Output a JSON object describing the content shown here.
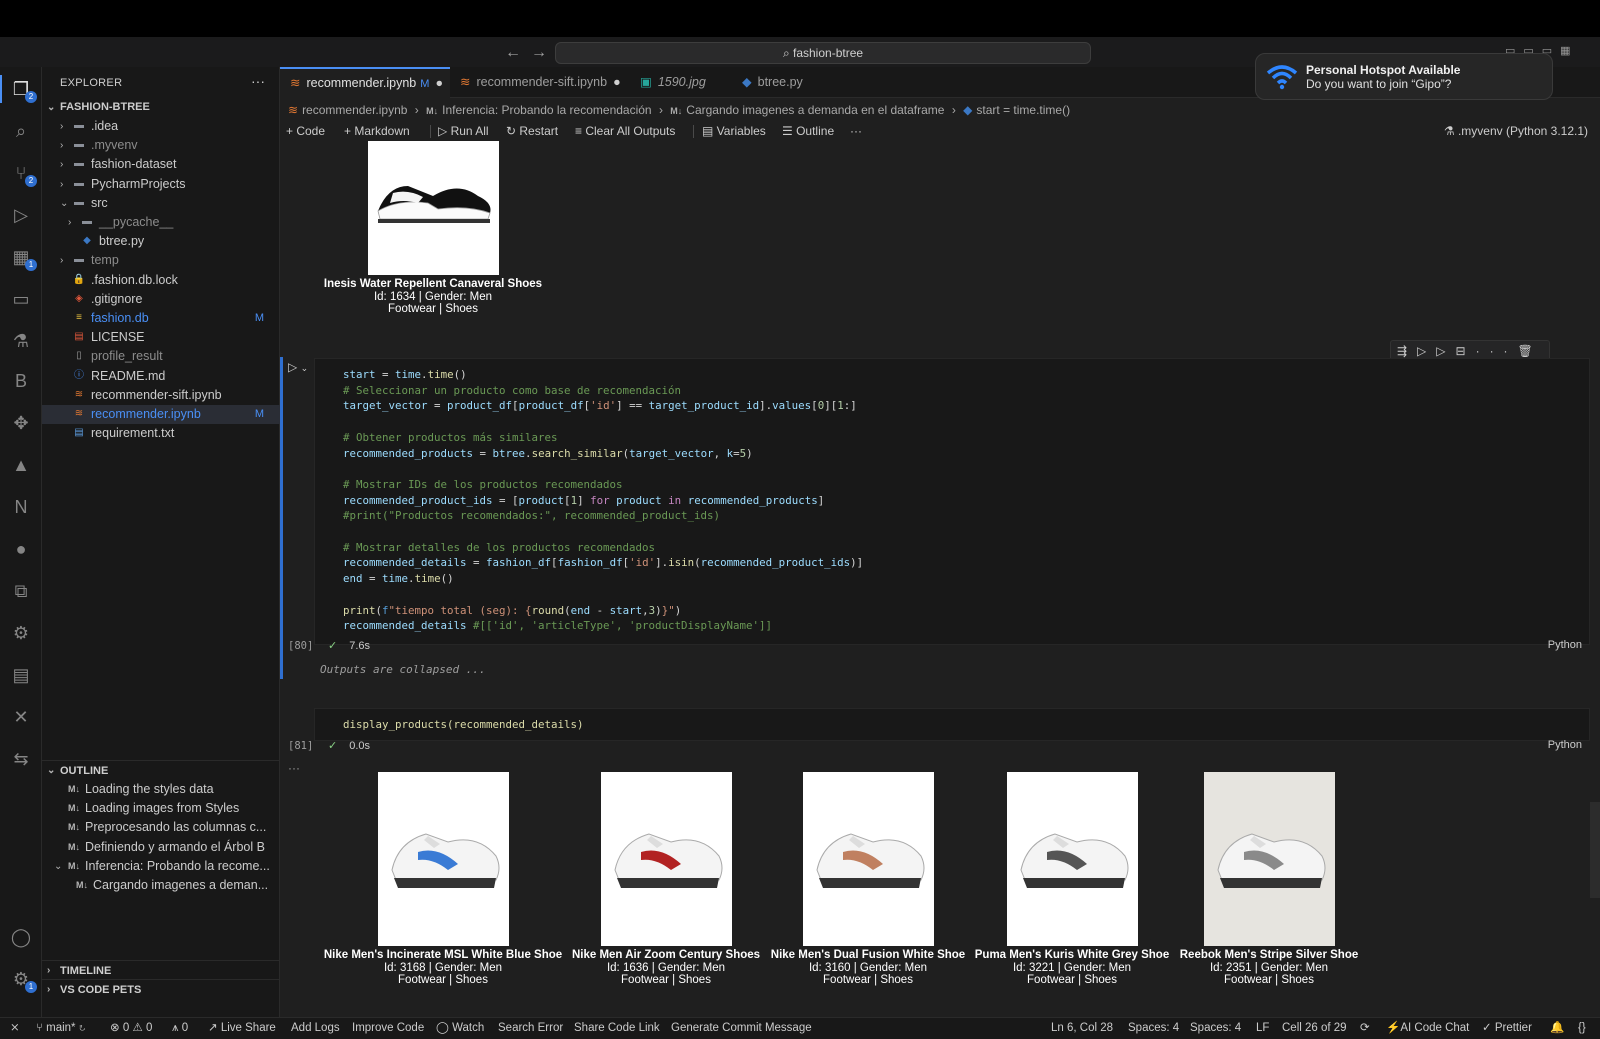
{
  "window": {
    "search_title": "fashion-btree"
  },
  "notification": {
    "title": "Personal Hotspot Available",
    "body": "Do you want to join “Gipo”?"
  },
  "explorer": {
    "title": "EXPLORER",
    "root": "FASHION-BTREE",
    "items": [
      {
        "label": ".idea",
        "type": "folder",
        "expanded": false,
        "depth": 1
      },
      {
        "label": ".myvenv",
        "type": "folder",
        "expanded": false,
        "depth": 1
      },
      {
        "label": "fashion-dataset",
        "type": "folder",
        "expanded": false,
        "depth": 1
      },
      {
        "label": "PycharmProjects",
        "type": "folder",
        "expanded": false,
        "depth": 1
      },
      {
        "label": "src",
        "type": "folder",
        "expanded": true,
        "depth": 1
      },
      {
        "label": "__pycache__",
        "type": "folder",
        "expanded": false,
        "depth": 2
      },
      {
        "label": "btree.py",
        "type": "python",
        "depth": 2
      },
      {
        "label": "temp",
        "type": "folder",
        "expanded": false,
        "depth": 1
      },
      {
        "label": ".fashion.db.lock",
        "type": "lock",
        "depth": 1
      },
      {
        "label": ".gitignore",
        "type": "git",
        "depth": 1
      },
      {
        "label": "fashion.db",
        "type": "db",
        "depth": 1,
        "badge": "M"
      },
      {
        "label": "LICENSE",
        "type": "license",
        "depth": 1
      },
      {
        "label": "profile_result",
        "type": "file",
        "depth": 1
      },
      {
        "label": "README.md",
        "type": "info",
        "depth": 1
      },
      {
        "label": "recommender-sift.ipynb",
        "type": "notebook",
        "depth": 1
      },
      {
        "label": "recommender.ipynb",
        "type": "notebook",
        "depth": 1,
        "badge": "M",
        "selected": true
      },
      {
        "label": "requirement.txt",
        "type": "text",
        "depth": 1
      }
    ]
  },
  "outline": {
    "title": "OUTLINE",
    "items": [
      {
        "label": "Loading the styles data",
        "depth": 1
      },
      {
        "label": "Loading images from Styles",
        "depth": 1
      },
      {
        "label": "Preprocesando las columnas c...",
        "depth": 1
      },
      {
        "label": "Definiendo y armando el Árbol B",
        "depth": 1
      },
      {
        "label": "Inferencia: Probando la recome...",
        "depth": 1,
        "expanded": true
      },
      {
        "label": "Cargando imagenes a deman...",
        "depth": 2
      }
    ]
  },
  "timeline": {
    "title": "TIMELINE"
  },
  "pets": {
    "title": "VS CODE PETS"
  },
  "tabs": [
    {
      "label": "recommender.ipynb",
      "badge": "M",
      "modified": true,
      "active": true
    },
    {
      "label": "recommender-sift.ipynb",
      "modified": true
    },
    {
      "label": "1590.jpg",
      "italic": true
    },
    {
      "label": "btree.py"
    }
  ],
  "breadcrumb": {
    "file": "recommender.ipynb",
    "section": "Inferencia: Probando la recomendación",
    "subsection": "Cargando imagenes a demanda en el dataframe",
    "symbol": "start = time.time()"
  },
  "toolbar": {
    "code": "Code",
    "markdown": "Markdown",
    "run_all": "Run All",
    "restart": "Restart",
    "clear_outputs": "Clear All Outputs",
    "variables": "Variables",
    "outline": "Outline",
    "kernel": ".myvenv (Python 3.12.1)"
  },
  "top_product": {
    "name": "Inesis Water Repellent Canaveral Shoes",
    "meta": "Id: 1634 | Gender: Men",
    "category": "Footwear | Shoes"
  },
  "cell80": {
    "count": "[80]",
    "time": "7.6s",
    "lang": "Python",
    "collapsed": "Outputs are collapsed ..."
  },
  "cell81": {
    "count": "[81]",
    "time": "0.0s",
    "lang": "Python",
    "code": "display_products(recommended_details)"
  },
  "products": [
    {
      "name": "Nike Men's Incinerate MSL White Blue Shoe",
      "meta": "Id: 3168 | Gender: Men",
      "category": "Footwear | Shoes"
    },
    {
      "name": "Nike Men Air Zoom Century Shoes",
      "meta": "Id: 1636 | Gender: Men",
      "category": "Footwear | Shoes"
    },
    {
      "name": "Nike Men's Dual Fusion White Shoe",
      "meta": "Id: 3160 | Gender: Men",
      "category": "Footwear | Shoes"
    },
    {
      "name": "Puma Men's Kuris White Grey Shoe",
      "meta": "Id: 3221 | Gender: Men",
      "category": "Footwear | Shoes"
    },
    {
      "name": "Reebok Men's Stripe Silver Shoe",
      "meta": "Id: 2351 | Gender: Men",
      "category": "Footwear | Shoes"
    }
  ],
  "status": {
    "branch": "main*",
    "errors": "0",
    "warnings": "0",
    "ports": "0",
    "live_share": "Live Share",
    "add_logs": "Add Logs",
    "improve_code": "Improve Code",
    "watch": "Watch",
    "search_error": "Search Error",
    "share_code": "Share Code Link",
    "commit_msg": "Generate Commit Message",
    "position": "Ln 6, Col 28",
    "spaces1": "Spaces: 4",
    "spaces2": "Spaces: 4",
    "eol": "LF",
    "cell": "Cell 26 of 29",
    "ai_chat": "AI Code Chat",
    "prettier": "Prettier"
  },
  "colors": {
    "accent": "#4a8ff5",
    "editor_bg": "#1f1f1f",
    "sidebar_bg": "#181818"
  }
}
